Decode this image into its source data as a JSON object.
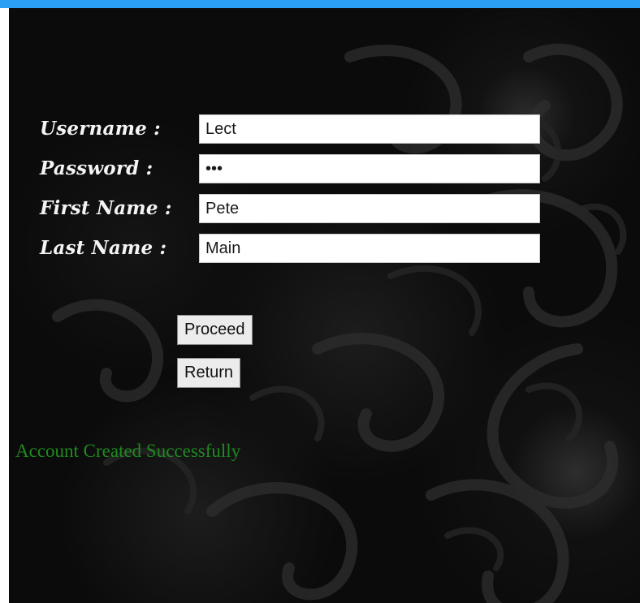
{
  "theme": {
    "top_bar_color": "#2a9ff3",
    "background": "dark floral damask",
    "status_color": "#1f8a1f"
  },
  "form": {
    "username": {
      "label": "Username :",
      "value": "Lect"
    },
    "password": {
      "label": "Password :",
      "value": "abc"
    },
    "first_name": {
      "label": "First Name :",
      "value": "Pete"
    },
    "last_name": {
      "label": "Last Name :",
      "value": "Main"
    }
  },
  "buttons": {
    "proceed_label": "Proceed",
    "return_label": "Return"
  },
  "status": {
    "message": "Account Created Successfully"
  }
}
